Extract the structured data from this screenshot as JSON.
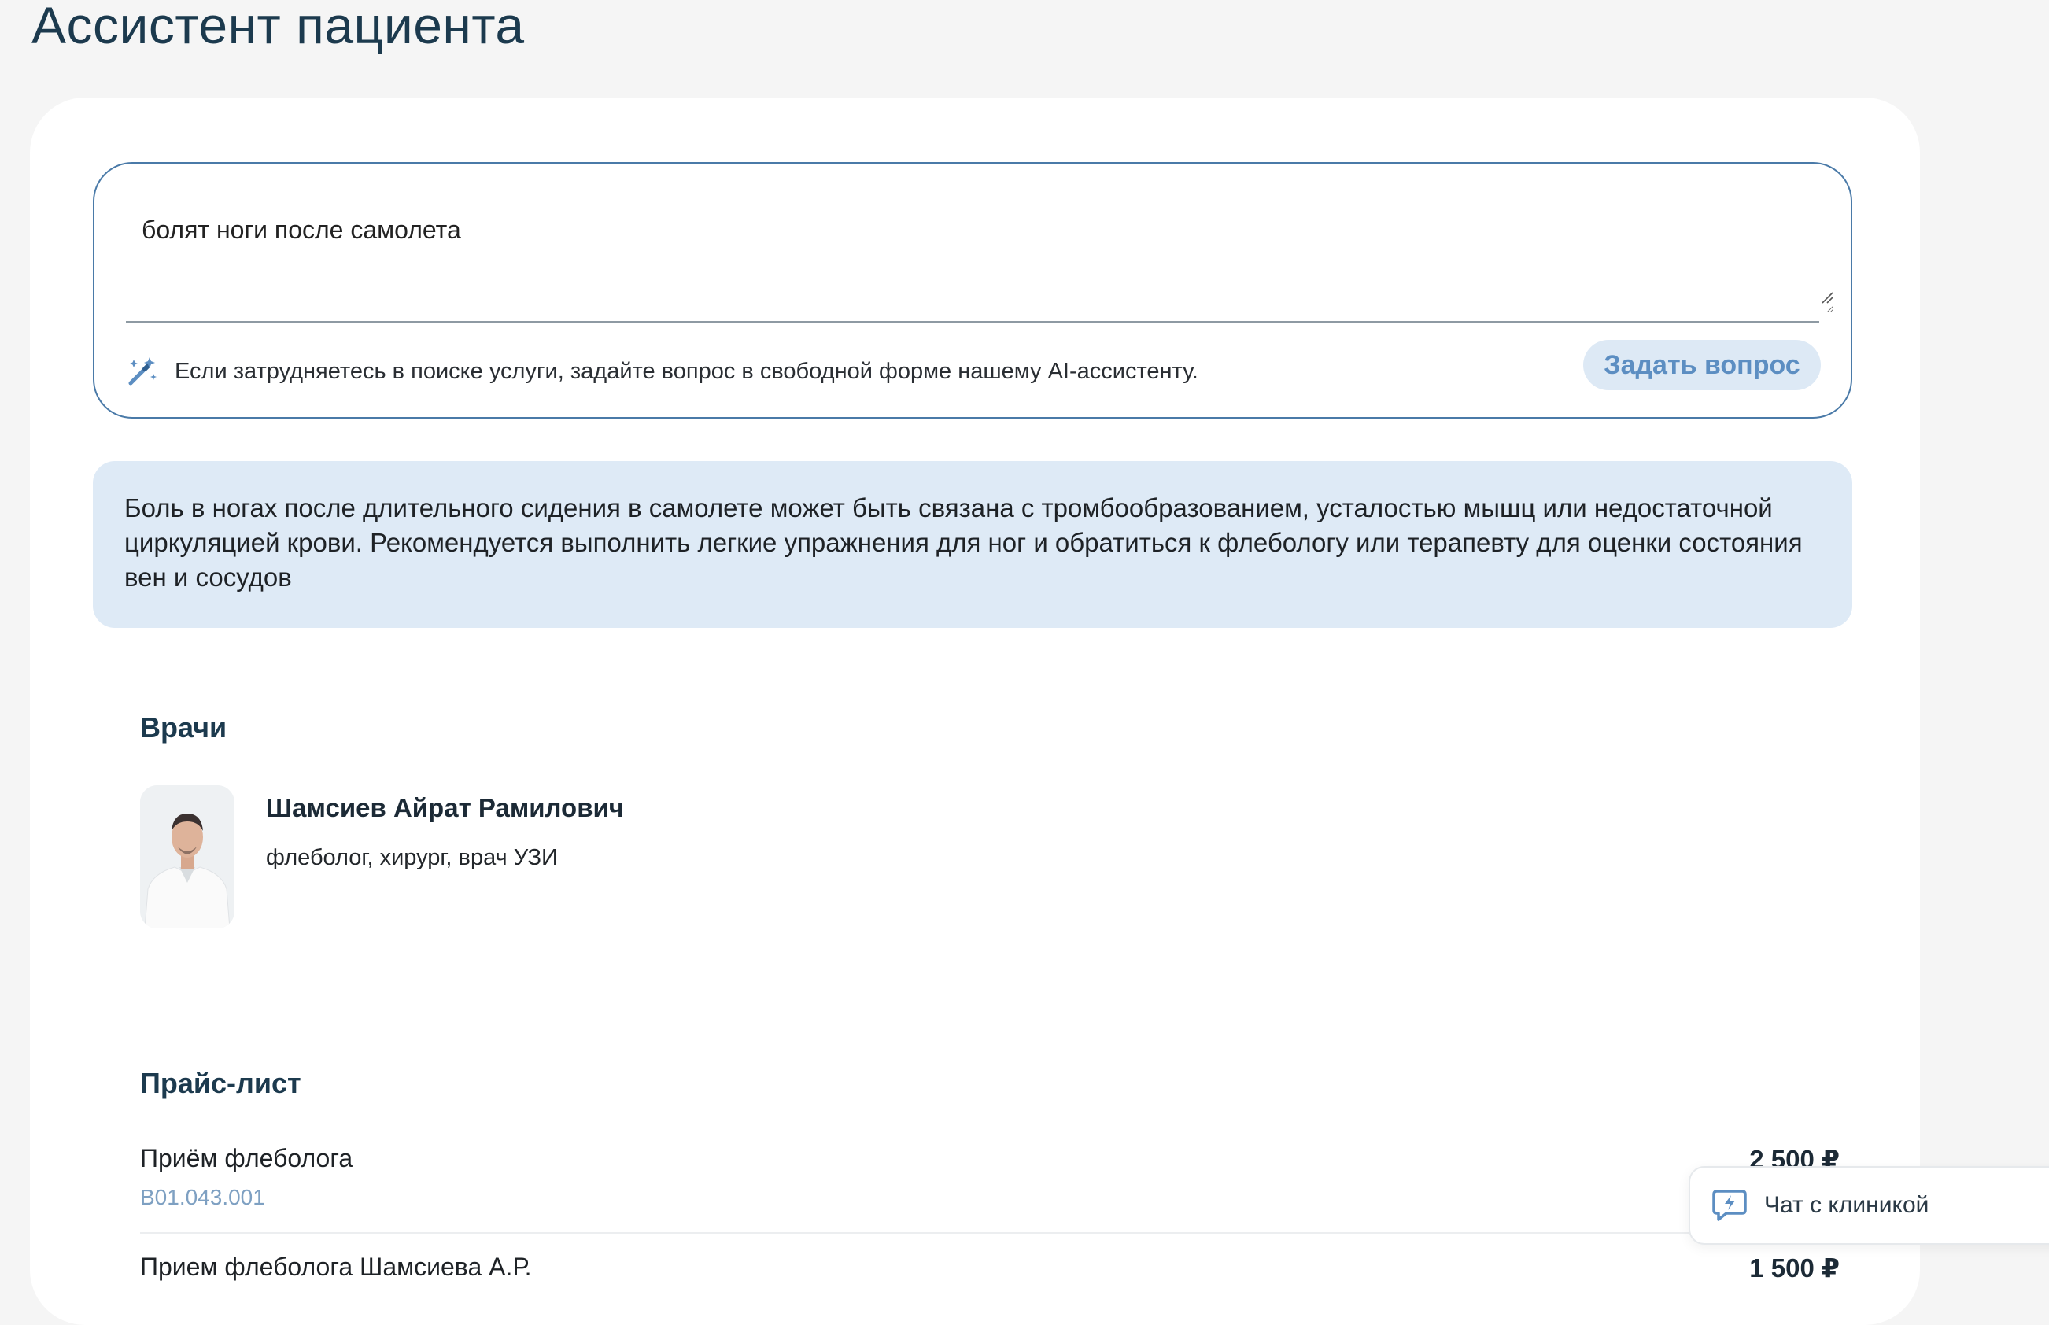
{
  "page": {
    "title": "Ассистент пациента"
  },
  "ask": {
    "query_value": "болят ноги после самолета",
    "hint": "Если затрудняетесь в поиске услуги, задайте вопрос в свободной форме нашему AI-ассистенту.",
    "button_label": "Задать вопрос"
  },
  "answer": {
    "text": "Боль в ногах после длительного сидения в самолете может быть связана с тромбообразованием, усталостью мышц или недостаточной циркуляцией крови. Рекомендуется выполнить легкие упражнения для ног и обратиться к флебологу или терапевту для оценки состояния вен и сосудов"
  },
  "doctors": {
    "heading": "Врачи",
    "items": [
      {
        "name": "Шамсиев Айрат Рамилович",
        "specialty": "флеболог, хирург, врач УЗИ"
      }
    ]
  },
  "price_list": {
    "heading": "Прайс-лист",
    "items": [
      {
        "name": "Приём флеболога",
        "code": "B01.043.001",
        "price": "2 500 ₽"
      },
      {
        "name": "Прием флеболога Шамсиева А.Р.",
        "price": "1 500 ₽"
      }
    ]
  },
  "chat": {
    "label": "Чат с клиникой"
  },
  "colors": {
    "accent": "#4a7aa8",
    "button_bg": "#dde9f5",
    "answer_bg": "#deeaf6",
    "heading": "#1c3a4e"
  },
  "icons": {
    "hint": "magic-wand-icon",
    "chat": "chat-bubble-icon",
    "resize": "resize-handle-icon"
  }
}
